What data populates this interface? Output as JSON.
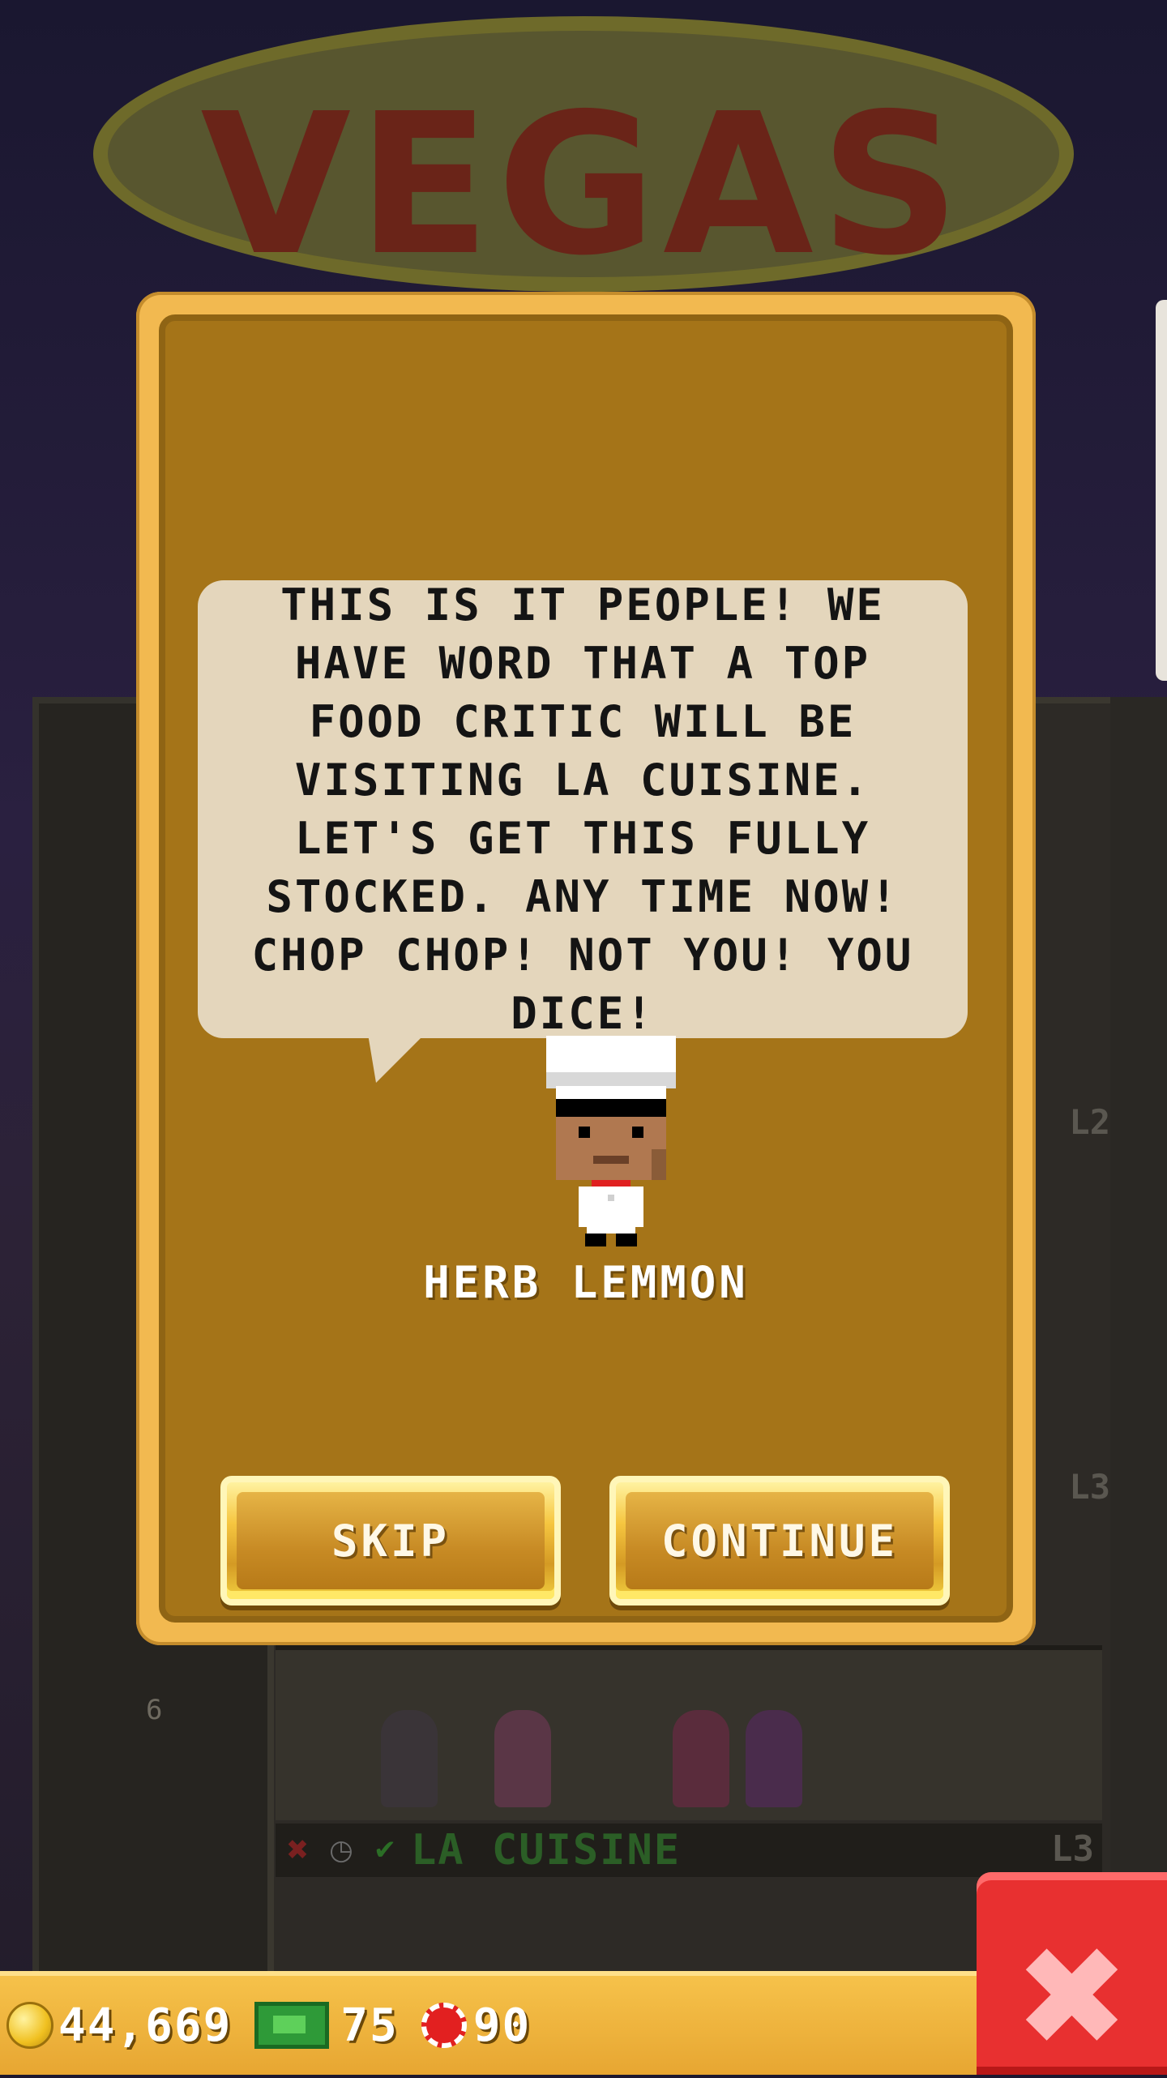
{
  "background": {
    "sign_text": "VEGAS",
    "floor_number": "6",
    "floor": {
      "name": "LA CUISINE",
      "level": "L3",
      "status_icons": [
        "x-icon",
        "clock-icon",
        "check-icon"
      ]
    },
    "side_tags": [
      "L2",
      "L3"
    ]
  },
  "dialog": {
    "message": "THIS IS IT PEOPLE! WE HAVE WORD THAT A TOP FOOD CRITIC WILL BE VISITING LA CUISINE. LET'S GET THIS FULLY STOCKED. ANY TIME NOW! CHOP CHOP! NOT YOU! YOU DICE!",
    "character_name": "HERB LEMMON",
    "skip_label": "SKIP",
    "continue_label": "CONTINUE"
  },
  "hud": {
    "coins": "44,669",
    "bux": "75",
    "chips": "90"
  },
  "colors": {
    "dialog_frame": "#f2b950",
    "dialog_body": "#a57418",
    "bubble": "#e4d6bc",
    "close_button": "#e83030"
  }
}
